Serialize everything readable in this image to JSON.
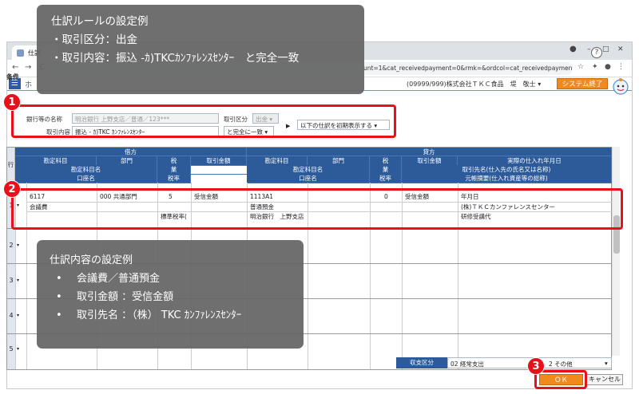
{
  "browser": {
    "tab_title": "仕訳",
    "url_text": "unt=1&cat_receivedpayment=0&rmk=&ordcol=cat_receivedpayment&directio...",
    "min_glyph": "–",
    "max_glyph": "□",
    "close_glyph": "✕",
    "back_glyph": "←",
    "forward_glyph": "→",
    "reload_glyph": "C"
  },
  "header": {
    "menu_glyph": "☰",
    "home_tab": "ホ",
    "company": "(09999/999)株式会社ＴＫＣ食品　堤　敬士 ▾",
    "system_end": "システム終了",
    "help": "?"
  },
  "condition": {
    "label": "条件",
    "bank_label": "銀行等の名称",
    "bank_value": "明治銀行 上野支店／普通／123***",
    "kind_label": "取引区分",
    "kind_value": "出金 ▾",
    "content_label": "取引内容",
    "content_value": "振込 - ｶ)TKC ｶﾝﾌｧﾚﾝｽｾﾝﾀｰ",
    "match_value": "と完全に一致 ▾",
    "display_value": "以下の仕訳を初期表示する ▾"
  },
  "grid": {
    "row_header": "行",
    "debit_group": "借方",
    "credit_group": "貸方",
    "debit_cols": {
      "r1": [
        "勘定科目",
        "部門",
        "税",
        "取引金額"
      ],
      "r2": [
        "勘定科目名",
        "業"
      ],
      "r3": [
        "口座名",
        "税率"
      ]
    },
    "credit_cols": {
      "r1": [
        "勘定科目",
        "部門",
        "税",
        "取引金額",
        "実際の仕入れ年月日"
      ],
      "r2": [
        "勘定科目名",
        "業",
        "取引先名(仕入先の氏名又は名称)"
      ],
      "r3": [
        "口座名",
        "税率",
        "元帳摘要(仕入れ資産等の総称)"
      ]
    },
    "row1": {
      "no": "1",
      "dot": "▾",
      "d_code": "6117",
      "d_dept": "000 共通部門",
      "d_tax": "5",
      "d_amount": "受信金額",
      "d_name": "会議費",
      "d_rate": "標準税率(",
      "c_code": "1113A1",
      "c_tax": "0",
      "c_amount": "受信金額",
      "c_name": "普通預金",
      "c_account": "明治銀行　上野支店",
      "c_date": "年月日",
      "c_partner": "(株)ＴＫＣカンファレンスセンター",
      "c_memo": "研修受講代"
    },
    "rows": [
      {
        "no": "2",
        "dot": "▾"
      },
      {
        "no": "3",
        "dot": "▾"
      },
      {
        "no": "4",
        "dot": "▾"
      },
      {
        "no": "5",
        "dot": "▾"
      }
    ]
  },
  "summary": {
    "label": "収支区分",
    "value1": "02 経常支出",
    "value2": "2 その他",
    "caret": "▾"
  },
  "buttons": {
    "ok": "ＯＫ",
    "cancel": "キャンセル"
  },
  "callout1": {
    "title": "仕訳ルールの設定例",
    "line1": "・取引区分：出金",
    "line2": "・取引内容：振込 -ｶ)TKCｶﾝﾌｧﾚﾝｽｾﾝﾀｰ　と完全一致"
  },
  "callout2": {
    "title": "仕訳内容の設定例",
    "bullet": "•",
    "line1": "会議費／普通預金",
    "line2": "取引金額 ：受信金額",
    "line3": "取引先名 ：（株） TKC ｶﾝﾌｧﾚﾝｽｾﾝﾀｰ"
  },
  "badges": {
    "b1": "1",
    "b2": "2",
    "b3": "3"
  },
  "colors": {
    "header_blue": "#2d5a99",
    "accent_orange": "#f08a1c",
    "highlight_red": "#e8101b",
    "callout_gray": "#646464"
  }
}
